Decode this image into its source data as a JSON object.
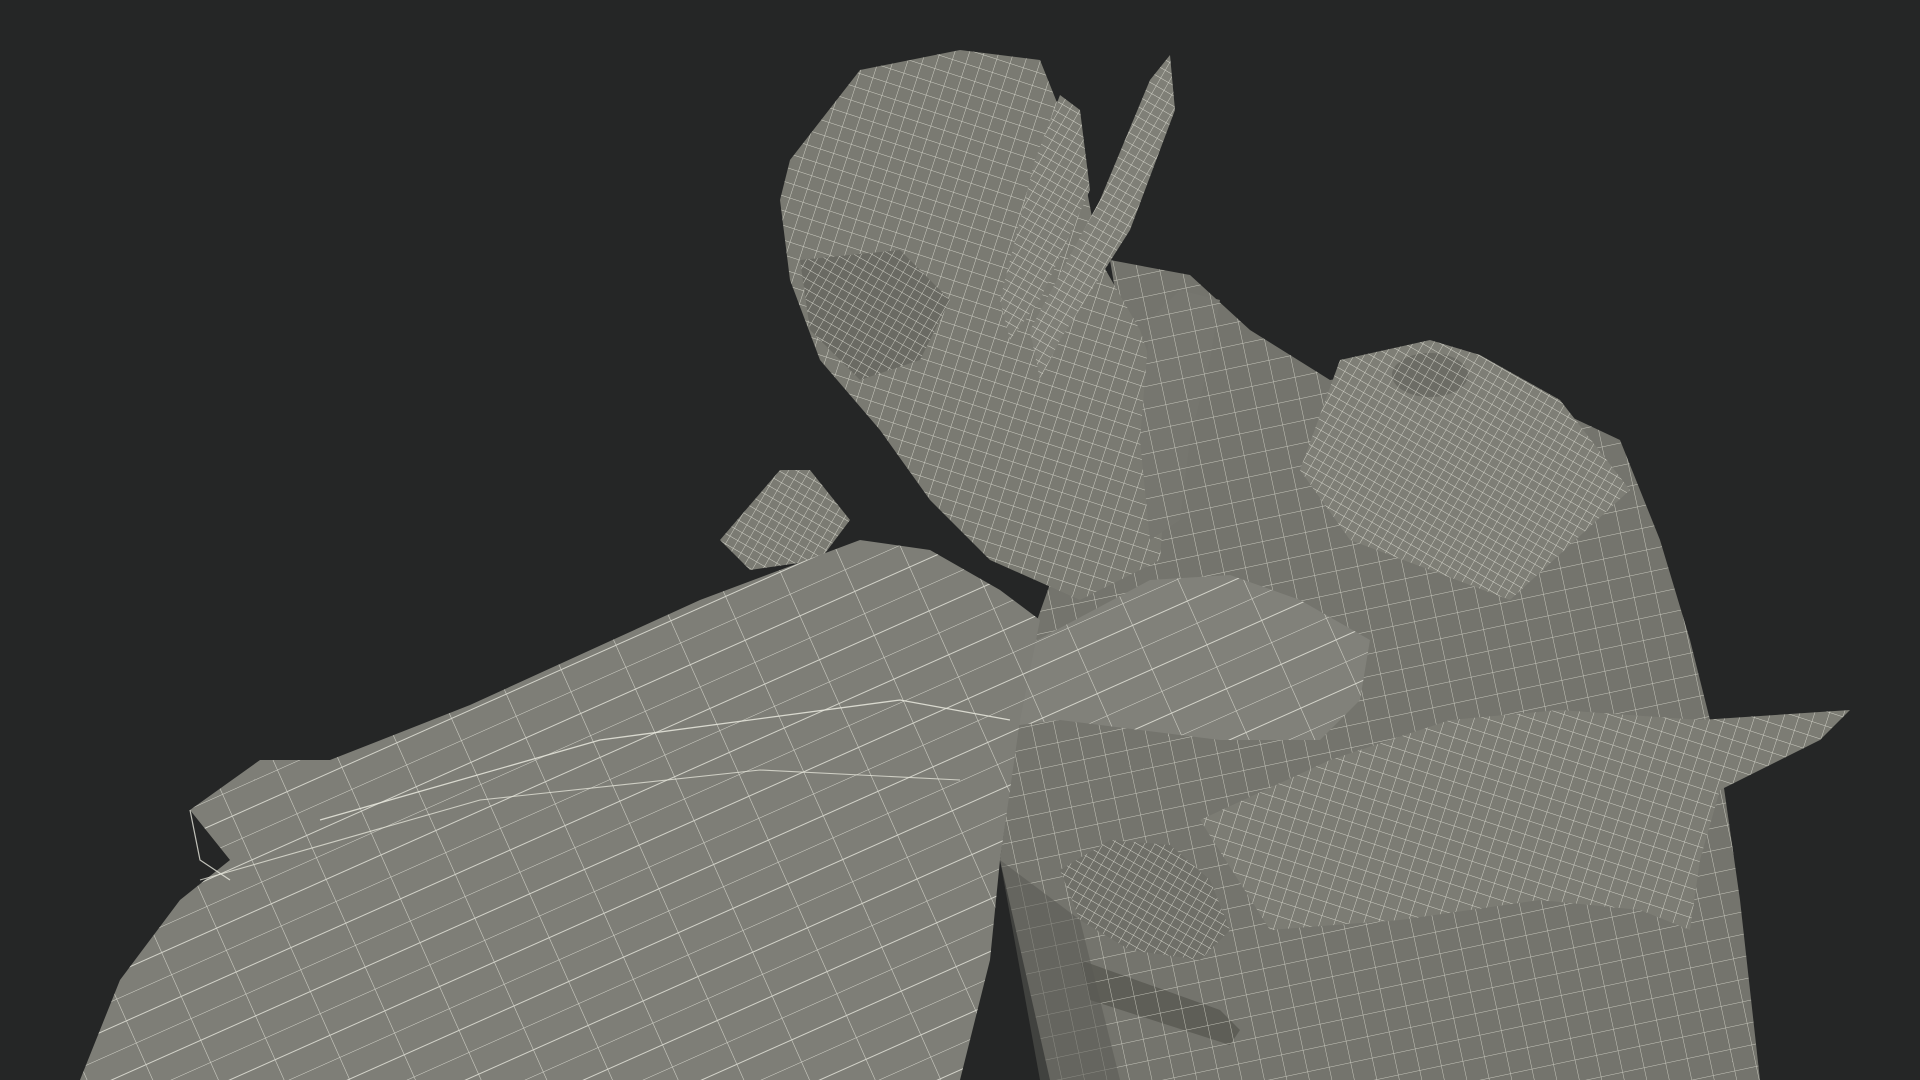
{
  "scene": {
    "subject": "wireframe-model",
    "colors": {
      "background": "#252626",
      "model_fill": "#7b7b73",
      "model_shade": "#5f5f58",
      "model_highlight": "#8a8a82",
      "wire": "#e9e9de"
    }
  }
}
